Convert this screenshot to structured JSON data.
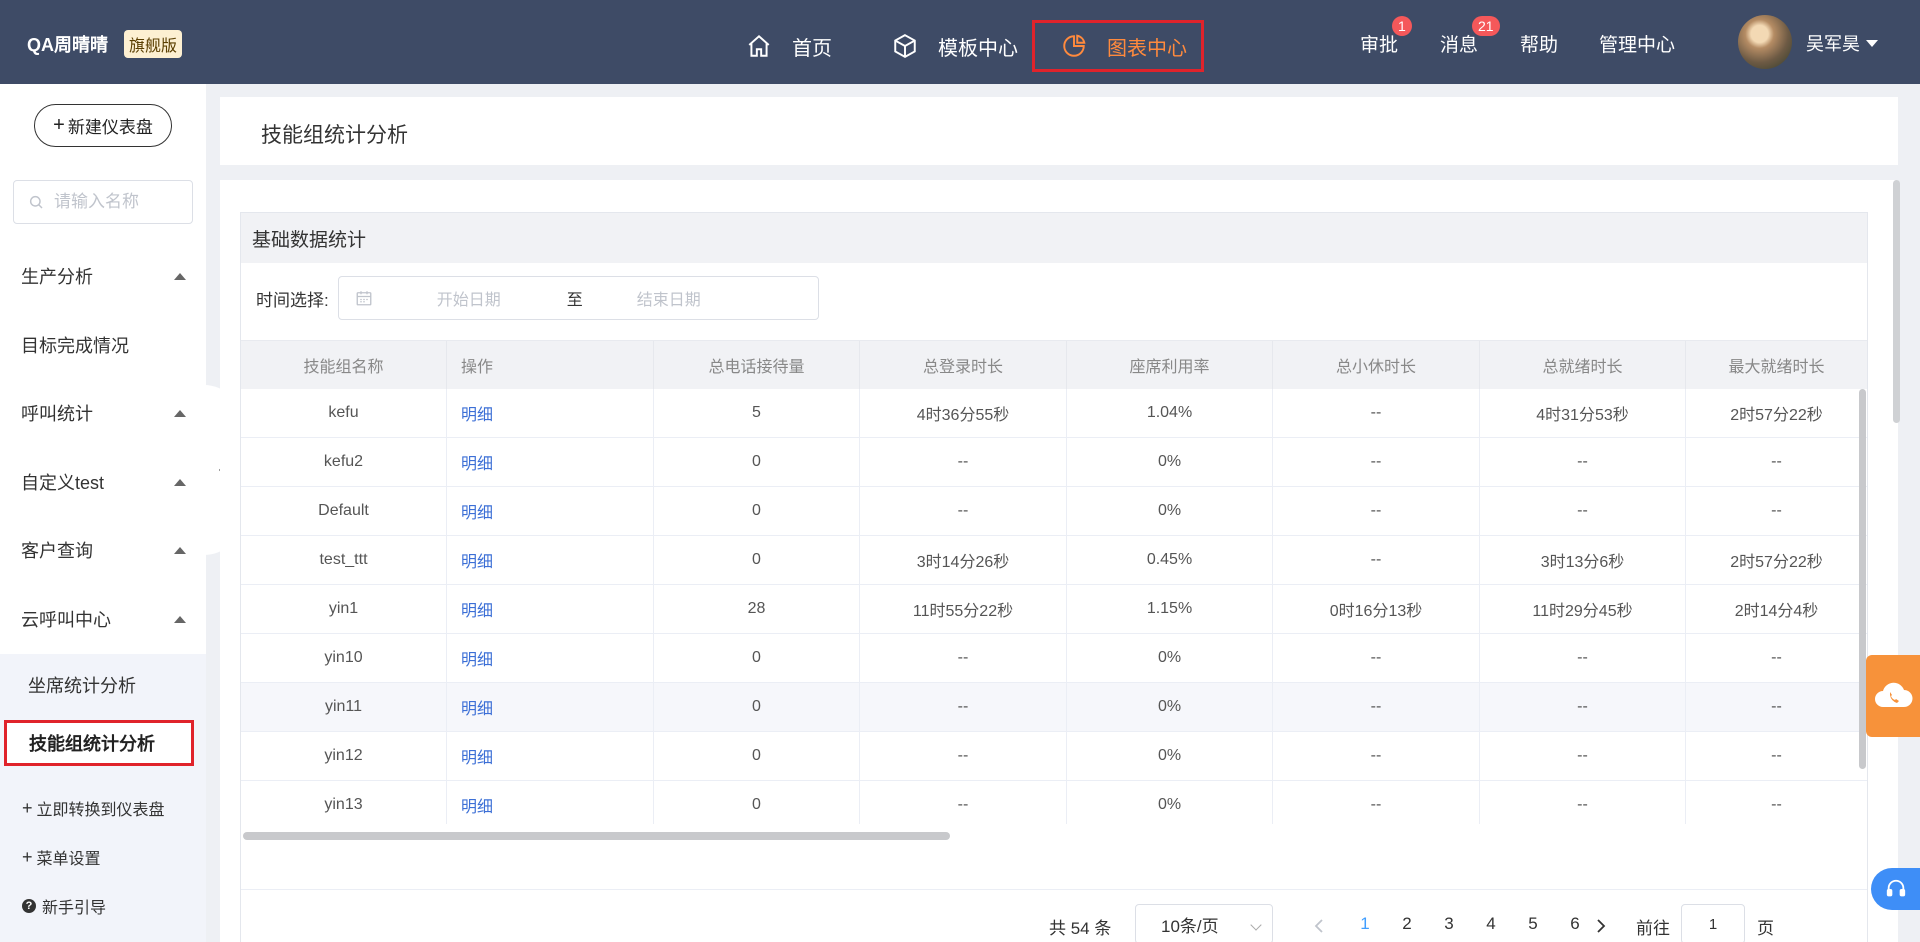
{
  "brand": {
    "name": "QA周晴晴",
    "badge": "旗舰版"
  },
  "nav": {
    "home": "首页",
    "template": "模板中心",
    "chart": "图表中心"
  },
  "topRight": {
    "approve": "审批",
    "approveCount": "1",
    "messages": "消息",
    "messageCount": "21",
    "help": "帮助",
    "admin": "管理中心",
    "user": "吴军昊"
  },
  "sidebar": {
    "newDashboard": "新建仪表盘",
    "searchPlaceholder": "请输入名称",
    "groups": [
      "生产分析",
      "目标完成情况",
      "呼叫统计",
      "自定义test",
      "客户查询",
      "云呼叫中心"
    ],
    "subItems": [
      "坐席统计分析",
      "技能组统计分析"
    ],
    "convert": "立即转换到仪表盘",
    "menuSettings": "菜单设置",
    "guide": "新手引导"
  },
  "page": {
    "title": "技能组统计分析",
    "cardTitle": "基础数据统计",
    "filterLabel": "时间选择:",
    "startPlaceholder": "开始日期",
    "rangeSep": "至",
    "endPlaceholder": "结束日期"
  },
  "table": {
    "columns": [
      "技能组名称",
      "操作",
      "总电话接待量",
      "总登录时长",
      "座席利用率",
      "总小休时长",
      "总就绪时长",
      "最大就绪时长"
    ],
    "rows": [
      [
        "kefu",
        "明细",
        "5",
        "4时36分55秒",
        "1.04%",
        "--",
        "4时31分53秒",
        "2时57分22秒"
      ],
      [
        "kefu2",
        "明细",
        "0",
        "--",
        "0%",
        "--",
        "--",
        "--"
      ],
      [
        "Default",
        "明细",
        "0",
        "--",
        "0%",
        "--",
        "--",
        "--"
      ],
      [
        "test_ttt",
        "明细",
        "0",
        "3时14分26秒",
        "0.45%",
        "--",
        "3时13分6秒",
        "2时57分22秒"
      ],
      [
        "yin1",
        "明细",
        "28",
        "11时55分22秒",
        "1.15%",
        "0时16分13秒",
        "11时29分45秒",
        "2时14分4秒"
      ],
      [
        "yin10",
        "明细",
        "0",
        "--",
        "0%",
        "--",
        "--",
        "--"
      ],
      [
        "yin11",
        "明细",
        "0",
        "--",
        "0%",
        "--",
        "--",
        "--"
      ],
      [
        "yin12",
        "明细",
        "0",
        "--",
        "0%",
        "--",
        "--",
        "--"
      ],
      [
        "yin13",
        "明细",
        "0",
        "--",
        "0%",
        "--",
        "--",
        "--"
      ]
    ]
  },
  "pager": {
    "total": "共 54 条",
    "pageSize": "10条/页",
    "pages": [
      "1",
      "2",
      "3",
      "4",
      "5",
      "6"
    ],
    "current": "1",
    "goto": "前往",
    "gotoValue": "1",
    "pageUnit": "页"
  }
}
